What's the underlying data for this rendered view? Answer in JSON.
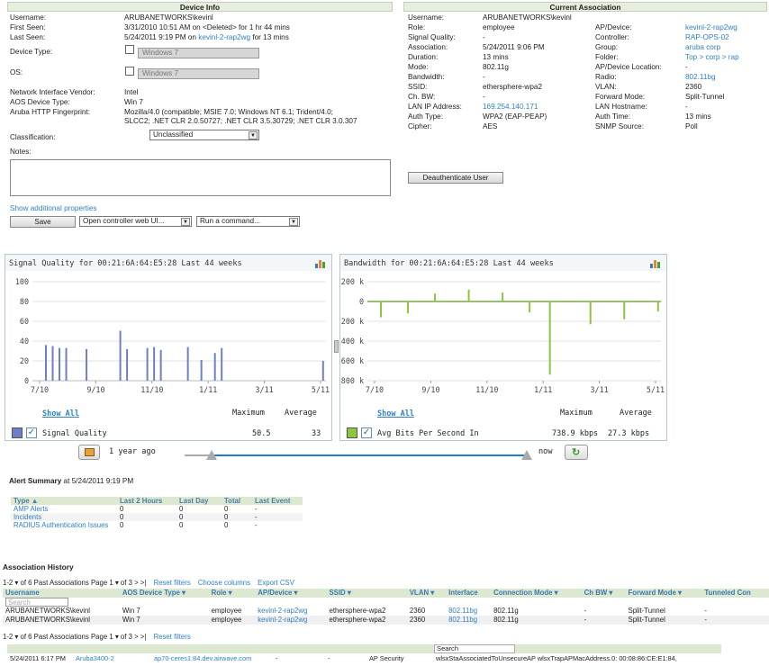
{
  "device_info": {
    "title": "Device Info",
    "rows": [
      {
        "label": "Username:",
        "value": "ARUBANETWORKS\\kevinl"
      },
      {
        "label": "First Seen:",
        "value": "3/31/2010 10:51 AM on <Deleted> for 1 hr 44 mins"
      },
      {
        "label": "Last Seen:",
        "value_pre": "5/24/2011 9:19 PM on ",
        "value_link": "kevinl-2-rap2wg",
        "value_post": " for 13 mins"
      }
    ],
    "device_type_label": "Device Type:",
    "device_type_value": "Windows 7",
    "os_label": "OS:",
    "os_value": "Windows 7",
    "nic_vendor_label": "Network Interface Vendor:",
    "nic_vendor_value": "Intel",
    "aos_device_type_label": "AOS Device Type:",
    "aos_device_type_value": "Win 7",
    "fingerprint_label": "Aruba HTTP Fingerprint:",
    "fingerprint_line1": "Mozilla/4.0 (compatible; MSIE 7.0; Windows NT 6.1; Trident/4.0;",
    "fingerprint_line2": "SLCC2; .NET CLR 2.0.50727; .NET CLR 3.5.30729; .NET CLR 3.0.307",
    "classification_label": "Classification:",
    "classification_value": "Unclassified",
    "notes_label": "Notes:",
    "show_additional": "Show additional properties",
    "save_label": "Save",
    "open_controller_label": "Open controller web UI...",
    "run_command_label": "Run a command..."
  },
  "current_association": {
    "title": "Current Association",
    "username_label": "Username:",
    "username_value": "ARUBANETWORKS\\kevinl",
    "left": [
      {
        "label": "Role:",
        "value": "employee"
      },
      {
        "label": "Signal Quality:",
        "value": "-"
      },
      {
        "label": "Association:",
        "value": "5/24/2011 9:06 PM"
      },
      {
        "label": "Duration:",
        "value": "13 mins"
      },
      {
        "label": "Mode:",
        "value": "802.11g"
      },
      {
        "label": "Bandwidth:",
        "value": "-"
      },
      {
        "label": "SSID:",
        "value": "ethersphere-wpa2"
      },
      {
        "label": "Ch. BW:",
        "value": "-"
      },
      {
        "label": "LAN IP Address:",
        "value": "169.254.140.171",
        "link": true
      },
      {
        "label": "Auth Type:",
        "value": "WPA2 (EAP-PEAP)"
      },
      {
        "label": "Cipher:",
        "value": "AES"
      }
    ],
    "right": [
      {
        "label": "AP/Device:",
        "value": "kevinl-2-rap2wg",
        "link": true
      },
      {
        "label": "Controller:",
        "value": "RAP-OPS-02",
        "link": true
      },
      {
        "label": "Group:",
        "value": "aruba corp",
        "link": true
      },
      {
        "label": "Folder:",
        "value": "Top > corp > rap",
        "link": true
      },
      {
        "label": "AP/Device Location:",
        "value": "-"
      },
      {
        "label": "Radio:",
        "value": "802.11bg",
        "link": true
      },
      {
        "label": "VLAN:",
        "value": "2360"
      },
      {
        "label": "Forward Mode:",
        "value": "Split-Tunnel"
      },
      {
        "label": "LAN Hostname:",
        "value": "-"
      },
      {
        "label": "Auth Time:",
        "value": "13 mins"
      },
      {
        "label": "SNMP Source:",
        "value": "Poll"
      }
    ],
    "deauth_label": "Deauthenticate User"
  },
  "signal_chart": {
    "title": "Signal Quality for 00:21:6A:64:E5:28   Last 44 weeks",
    "y_ticks": [
      "100",
      "80",
      "60",
      "40",
      "20",
      "0"
    ],
    "x_ticks": [
      "7/10",
      "9/10",
      "11/10",
      "1/11",
      "3/11",
      "5/11"
    ],
    "show_all": "Show All",
    "max_label": "Maximum",
    "avg_label": "Average",
    "legend": "Signal Quality",
    "max_value": "50.5",
    "avg_value": "33",
    "color": "#6f7fc7"
  },
  "bandwidth_chart": {
    "title": "Bandwidth for 00:21:6A:64:E5:28   Last 44 weeks",
    "y_ticks": [
      "200 k",
      "0",
      "200 k",
      "400 k",
      "600 k",
      "800 k"
    ],
    "x_ticks": [
      "7/10",
      "9/10",
      "11/10",
      "1/11",
      "3/11",
      "5/11"
    ],
    "show_all": "Show All",
    "max_label": "Maximum",
    "avg_label": "Average",
    "legend": "Avg Bits Per Second In",
    "max_value": "738.9 kbps",
    "avg_value": "27.3 kbps",
    "color": "#8cc63f"
  },
  "chart_data": [
    {
      "type": "bar",
      "x": [
        "2010-07-15",
        "2010-07-22",
        "2010-07-29",
        "2010-08-05",
        "2010-08-26",
        "2010-09-30",
        "2010-10-07",
        "2010-10-28",
        "2010-11-04",
        "2010-11-11",
        "2010-12-09",
        "2010-12-23",
        "2011-01-06",
        "2011-01-13",
        "2011-04-28"
      ],
      "values": [
        36,
        35,
        33,
        33,
        32,
        50.5,
        32,
        33,
        34,
        31,
        34,
        21,
        28,
        33,
        20
      ],
      "ylim": [
        0,
        100
      ],
      "x_ticks": [
        "7/10",
        "9/10",
        "11/10",
        "1/11",
        "3/11",
        "5/11"
      ]
    },
    {
      "type": "bar",
      "x": [
        "2010-07-15",
        "2010-08-12",
        "2010-09-09",
        "2010-10-14",
        "2010-11-18",
        "2010-12-16",
        "2011-01-06",
        "2011-02-17",
        "2011-03-24",
        "2011-04-28"
      ],
      "values": [
        -160,
        -120,
        80,
        120,
        90,
        -110,
        -738.9,
        -230,
        -180,
        -100
      ],
      "ylim": [
        -800,
        200
      ],
      "x_ticks": [
        "7/10",
        "9/10",
        "11/10",
        "1/11",
        "3/11",
        "5/11"
      ]
    }
  ],
  "time_range": {
    "start_label": "1 year ago",
    "end_label": "now",
    "start_fraction": 0.08,
    "end_fraction": 1.0
  },
  "alert_summary": {
    "title": "Alert Summary",
    "subtitle": " at 5/24/2011 9:19 PM",
    "headers": [
      "Type ▲",
      "Last 2 Hours",
      "Last Day",
      "Total",
      "Last Event"
    ],
    "rows": [
      [
        "AMP Alerts",
        "0",
        "0",
        "0",
        "-"
      ],
      [
        "Incidents",
        "0",
        "0",
        "0",
        "-"
      ],
      [
        "RADIUS Authentication Issues",
        "0",
        "0",
        "0",
        "-"
      ]
    ]
  },
  "association_history": {
    "title": "Association History",
    "pager_top": "1-2 ▾ of 6 Past Associations   Page 1 ▾ of 3  >  >|",
    "reset_filters": "Reset filters",
    "choose_columns": "Choose columns",
    "export_csv": "Export CSV",
    "headers": [
      "Username",
      "AOS Device Type ▾",
      "Role ▾",
      "AP/Device ▾",
      "SSID ▾",
      "VLAN ▾",
      "Interface",
      "Connection Mode ▾",
      "Ch BW ▾",
      "Forward Mode ▾",
      "Tunneled Con"
    ],
    "search_placeholder": "Search",
    "rows": [
      [
        "ARUBANETWORKS\\kevinl",
        "Win 7",
        "employee",
        "kevinl-2-rap2wg",
        "ethersphere-wpa2",
        "2360",
        "802.11bg",
        "802.11g",
        "-",
        "Split-Tunnel",
        "-"
      ],
      [
        "ARUBANETWORKS\\kevinl",
        "Win 7",
        "employee",
        "kevinl-2-rap2wg",
        "ethersphere-wpa2",
        "2360",
        "802.11bg",
        "802.11g",
        "-",
        "Split-Tunnel",
        "-"
      ]
    ],
    "pager_bottom": "1-2 ▾ of 6 Past Associations   Page 1 ▾ of 3  >  >|",
    "reset_filters_bottom": "Reset filters"
  },
  "event_log": {
    "search_label": "Search",
    "row": {
      "time": "5/24/2011 6:17 PM",
      "device": "Aruba3400-2",
      "source": "ap70-ceres1:84.dev.airwave.com",
      "dash1": "-",
      "dash2": "-",
      "category": "AP Security",
      "message": "wlsxStaAssociatedToUnsecureAP wlsxTrapAPMacAddress.0: 00:08:86:CE:E1:84,"
    }
  }
}
